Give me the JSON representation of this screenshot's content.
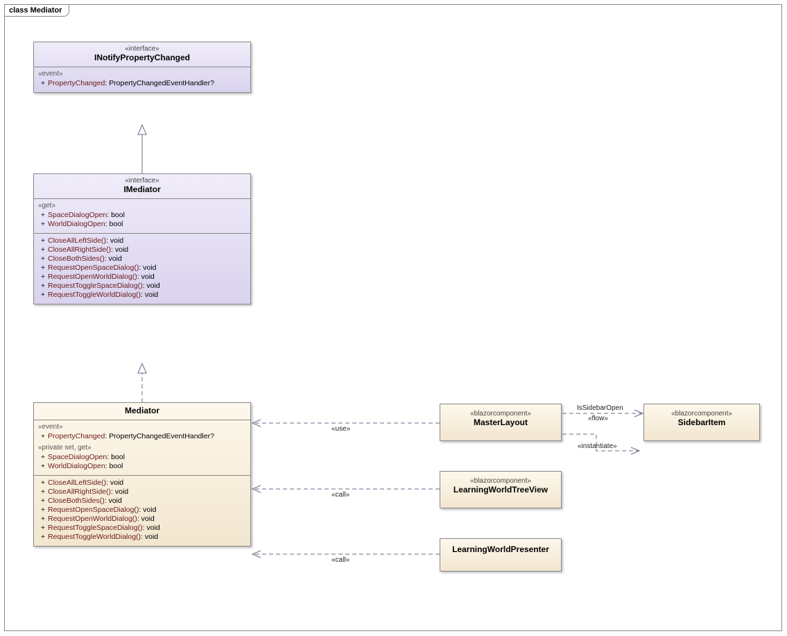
{
  "frame": {
    "kind": "class",
    "name": "Mediator"
  },
  "interfaces": {
    "inotify": {
      "stereo": "«interface»",
      "title": "INotifyPropertyChanged",
      "compartments": [
        {
          "label": "«event»",
          "members": [
            {
              "vis": "+",
              "name": "PropertyChanged",
              "sig": ": PropertyChangedEventHandler?"
            }
          ]
        }
      ]
    },
    "imediator": {
      "stereo": "«interface»",
      "title": "IMediator",
      "compartments": [
        {
          "label": "«get»",
          "members": [
            {
              "vis": "+",
              "name": "SpaceDialogOpen",
              "sig": ": bool"
            },
            {
              "vis": "+",
              "name": "WorldDialogOpen",
              "sig": ": bool"
            }
          ]
        },
        {
          "label": "",
          "members": [
            {
              "vis": "+",
              "name": "CloseAllLeftSide()",
              "sig": ": void"
            },
            {
              "vis": "+",
              "name": "CloseAllRightSide()",
              "sig": ": void"
            },
            {
              "vis": "+",
              "name": "CloseBothSides()",
              "sig": ": void"
            },
            {
              "vis": "+",
              "name": "RequestOpenSpaceDialog()",
              "sig": ": void"
            },
            {
              "vis": "+",
              "name": "RequestOpenWorldDialog()",
              "sig": ": void"
            },
            {
              "vis": "+",
              "name": "RequestToggleSpaceDialog()",
              "sig": ": void"
            },
            {
              "vis": "+",
              "name": "RequestToggleWorldDialog()",
              "sig": ": void"
            }
          ]
        }
      ]
    }
  },
  "mediator": {
    "title": "Mediator",
    "compartments": [
      {
        "label": "«event»",
        "members": [
          {
            "vis": "+",
            "name": "PropertyChanged",
            "sig": ": PropertyChangedEventHandler?"
          }
        ],
        "label2": "«private set, get»",
        "members2": [
          {
            "vis": "+",
            "name": "SpaceDialogOpen",
            "sig": ": bool"
          },
          {
            "vis": "+",
            "name": "WorldDialogOpen",
            "sig": ": bool"
          }
        ]
      },
      {
        "label": "",
        "members": [
          {
            "vis": "+",
            "name": "CloseAllLeftSide()",
            "sig": ": void"
          },
          {
            "vis": "+",
            "name": "CloseAllRightSide()",
            "sig": ": void"
          },
          {
            "vis": "+",
            "name": "CloseBothSides()",
            "sig": ": void"
          },
          {
            "vis": "+",
            "name": "RequestOpenSpaceDialog()",
            "sig": ": void"
          },
          {
            "vis": "+",
            "name": "RequestOpenWorldDialog()",
            "sig": ": void"
          },
          {
            "vis": "+",
            "name": "RequestToggleSpaceDialog()",
            "sig": ": void"
          },
          {
            "vis": "+",
            "name": "RequestToggleWorldDialog()",
            "sig": ": void"
          }
        ]
      }
    ]
  },
  "components": {
    "masterlayout": {
      "stereo": "«blazorcomponent»",
      "title": "MasterLayout"
    },
    "treeview": {
      "stereo": "«blazorcomponent»",
      "title": "LearningWorldTreeView"
    },
    "presenter": {
      "stereo": "",
      "title": "LearningWorldPresenter"
    },
    "sidebaritem": {
      "stereo": "«blazorcomponent»",
      "title": "SidebarItem"
    }
  },
  "relations": {
    "use": "«use»",
    "call1": "«call»",
    "call2": "«call»",
    "flowName": "IsSidebarOpen",
    "flow": "«flow»",
    "instantiate": "«instantiate»"
  }
}
